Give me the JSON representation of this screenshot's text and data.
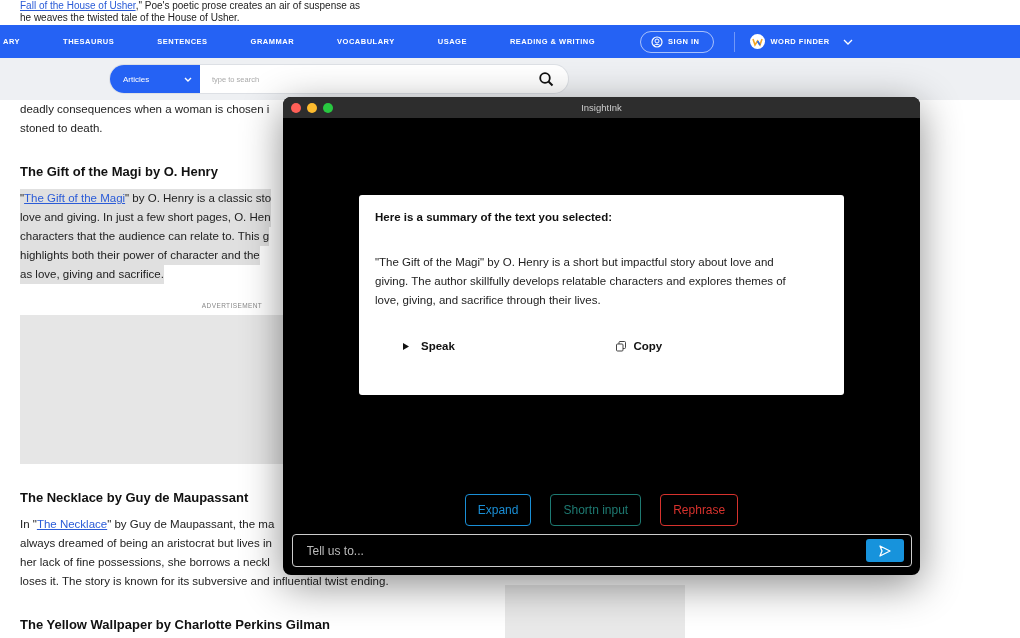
{
  "article_top": {
    "lines": [
      [
        {
          "text": "Fall of the House of Usher",
          "link": true
        },
        {
          "text": ",\" Poe's poetic prose creates an air of suspense as"
        }
      ],
      [
        {
          "text": "he weaves the twisted tale of the House of Usher."
        }
      ]
    ]
  },
  "nav": {
    "items": [
      {
        "label": "ARY"
      },
      {
        "label": "THESAURUS"
      },
      {
        "label": "SENTENCES"
      },
      {
        "label": "GRAMMAR"
      },
      {
        "label": "VOCABULARY"
      },
      {
        "label": "USAGE"
      },
      {
        "label": "READING & WRITING"
      }
    ],
    "sign_in": "SIGN IN",
    "word_finder": "WORD FINDER"
  },
  "search": {
    "category": "Articles",
    "placeholder": "type to search"
  },
  "article": [
    {
      "kind": "paragraph",
      "highlighted": false,
      "lines": [
        [
          {
            "text": "deadly consequences when a woman is chosen i"
          }
        ],
        [
          {
            "text": "stoned to death."
          }
        ]
      ]
    },
    {
      "kind": "heading",
      "text": "The Gift of the Magi by O. Henry"
    },
    {
      "kind": "paragraph",
      "highlighted": true,
      "lines": [
        [
          {
            "text": "\""
          },
          {
            "text": "The Gift of the Magi",
            "link": true
          },
          {
            "text": "\" by O. Henry is a classic sto"
          }
        ],
        [
          {
            "text": "love and giving. In just a few short pages, O. Hen"
          }
        ],
        [
          {
            "text": "characters that the audience can relate to. This g"
          }
        ],
        [
          {
            "text": "highlights both their power of character and the"
          }
        ],
        [
          {
            "text": "as love, giving and sacrifice."
          }
        ]
      ]
    },
    {
      "kind": "ad",
      "label": "ADVERTISEMENT"
    },
    {
      "kind": "heading",
      "text": "The Necklace by Guy de Maupassant"
    },
    {
      "kind": "paragraph",
      "highlighted": false,
      "lines": [
        [
          {
            "text": "In \""
          },
          {
            "text": "The Necklace",
            "link": true
          },
          {
            "text": "\" by Guy de Maupassant, the ma"
          }
        ],
        [
          {
            "text": "always dreamed of being an aristocrat but lives in"
          }
        ],
        [
          {
            "text": "her lack of fine possessions, she borrows a neckl"
          }
        ],
        [
          {
            "text": "loses it. The story is known for its subversive and influential twist ending."
          }
        ]
      ]
    },
    {
      "kind": "heading",
      "text": "The Yellow Wallpaper by Charlotte Perkins Gilman"
    }
  ],
  "app_window": {
    "title": "InsightInk",
    "summary": {
      "heading": "Here is a summary of the text you selected:",
      "body": "\"The Gift of the Magi\" by O. Henry is a short but impactful story about love and giving. The author skillfully develops relatable characters and explores themes of love, giving, and sacrifice through their lives.",
      "actions": [
        {
          "kind": "speak",
          "label": "Speak"
        },
        {
          "kind": "copy",
          "label": "Copy"
        }
      ]
    },
    "quick_actions": [
      {
        "label": "Expand",
        "color": "#1a8fd6"
      },
      {
        "label": "Shortn input",
        "color": "#1e7a72"
      },
      {
        "label": "Rephrase",
        "color": "#d6322d"
      }
    ],
    "input": {
      "placeholder": "Tell us to..."
    }
  }
}
